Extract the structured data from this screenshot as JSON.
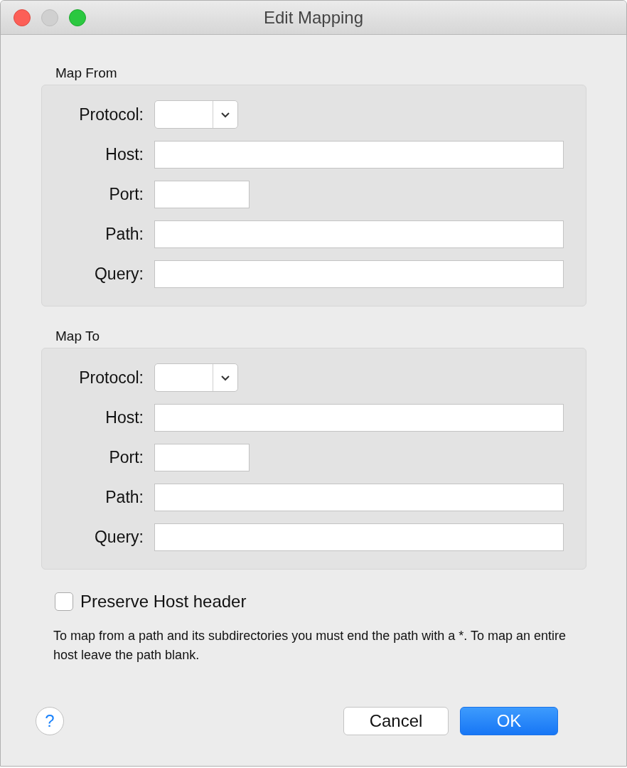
{
  "window": {
    "title": "Edit Mapping"
  },
  "sections": [
    {
      "title": "Map From",
      "fields": [
        {
          "kind": "select",
          "label": "Protocol:"
        },
        {
          "kind": "text",
          "label": "Host:"
        },
        {
          "kind": "short",
          "label": "Port:"
        },
        {
          "kind": "text",
          "label": "Path:"
        },
        {
          "kind": "text",
          "label": "Query:"
        }
      ]
    },
    {
      "title": "Map To",
      "fields": [
        {
          "kind": "select",
          "label": "Protocol:"
        },
        {
          "kind": "text",
          "label": "Host:"
        },
        {
          "kind": "short",
          "label": "Port:"
        },
        {
          "kind": "text",
          "label": "Path:"
        },
        {
          "kind": "text",
          "label": "Query:"
        }
      ]
    }
  ],
  "checkbox": {
    "label": "Preserve Host header",
    "checked": false
  },
  "note": "To map from a path and its subdirectories you must end the path with a *. To map an entire host leave the path blank.",
  "help": "?",
  "buttons": [
    {
      "label": "Cancel",
      "kind": "default"
    },
    {
      "label": "OK",
      "kind": "primary"
    }
  ]
}
